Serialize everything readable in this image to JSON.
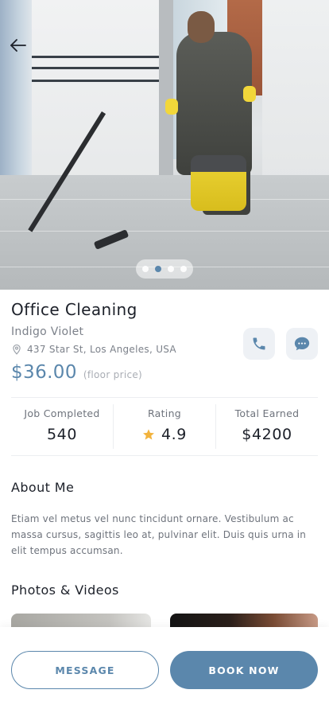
{
  "service": {
    "title": "Office Cleaning",
    "provider": "Indigo Violet",
    "address": "437 Star St, Los Angeles, USA",
    "price": "$36.00",
    "price_note": "(floor price)"
  },
  "carousel": {
    "count": 4,
    "active_index": 1
  },
  "stats": {
    "jobs_label": "Job Completed",
    "jobs_value": "540",
    "rating_label": "Rating",
    "rating_value": "4.9",
    "earned_label": "Total Earned",
    "earned_value": "$4200"
  },
  "about": {
    "heading": "About Me",
    "text": "Etiam vel metus vel nunc tincidunt ornare. Vestibulum ac massa cursus, sagittis leo at, pulvinar elit. Duis quis urna in elit tempus accumsan."
  },
  "media": {
    "heading": "Photos & Videos"
  },
  "actions": {
    "message_label": "MESSAGE",
    "book_label": "BOOK NOW"
  },
  "colors": {
    "accent": "#5b87ac",
    "star": "#f2b33d",
    "text": "#1c2029",
    "muted": "#7c818a"
  },
  "icons": [
    "back-arrow-icon",
    "location-pin-icon",
    "phone-icon",
    "chat-icon",
    "star-icon"
  ]
}
